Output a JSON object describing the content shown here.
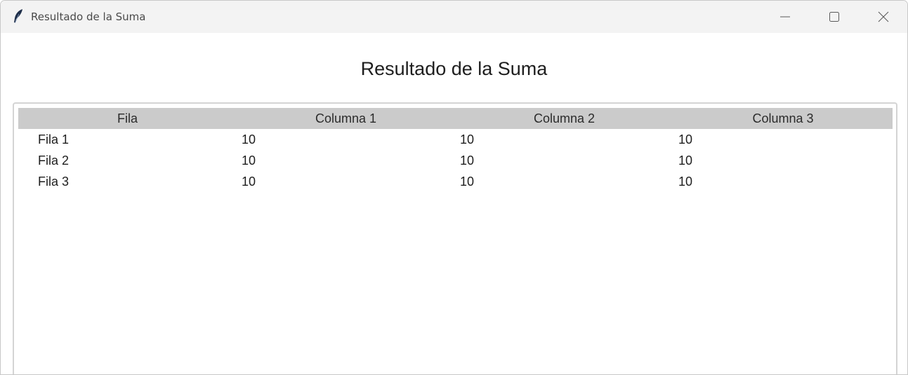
{
  "window": {
    "title": "Resultado de la Suma"
  },
  "heading": "Resultado de la Suma",
  "table": {
    "columns": [
      "Fila",
      "Columna 1",
      "Columna 2",
      "Columna 3"
    ],
    "rows": [
      [
        "Fila 1",
        "10",
        "10",
        "10"
      ],
      [
        "Fila 2",
        "10",
        "10",
        "10"
      ],
      [
        "Fila 3",
        "10",
        "10",
        "10"
      ]
    ]
  },
  "icons": {
    "app": "feather-icon",
    "minimize": "minimize-icon",
    "maximize": "maximize-icon",
    "close": "close-icon"
  },
  "colors": {
    "header_bg": "#cbcbcb",
    "titlebar_bg": "#f3f3f3"
  }
}
